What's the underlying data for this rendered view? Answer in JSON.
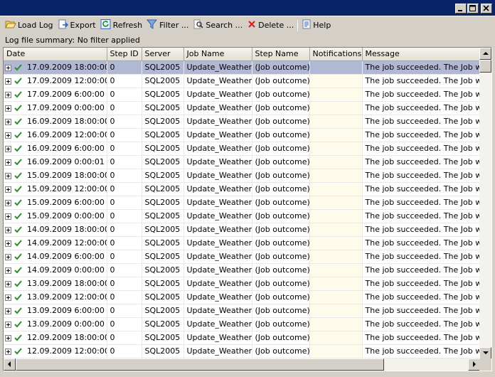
{
  "window": {
    "buttons": [
      "minimize-icon",
      "maximize-icon",
      "close-icon"
    ]
  },
  "toolbar": {
    "items": [
      {
        "label": "Load Log",
        "icon": "folder-open-icon"
      },
      {
        "label": "Export",
        "icon": "export-icon"
      },
      {
        "label": "Refresh",
        "icon": "refresh-icon"
      },
      {
        "label": "Filter ...",
        "icon": "filter-icon"
      },
      {
        "label": "Search ...",
        "icon": "search-icon"
      },
      {
        "label": "Delete ...",
        "icon": "delete-icon"
      },
      {
        "label": "Help",
        "icon": "help-icon"
      }
    ]
  },
  "summary": "Log file summary: No filter applied",
  "table": {
    "columns": [
      "Date",
      "Step ID",
      "Server",
      "Job Name",
      "Step Name",
      "Notifications",
      "Message"
    ],
    "rows": [
      {
        "date": "17.09.2009 18:00:00",
        "step_id": "0",
        "server": "SQL2005",
        "job": "Update_Weather",
        "step": "(Job outcome)",
        "notif": "",
        "message": "The job succeeded.  The Job was",
        "selected": true
      },
      {
        "date": "17.09.2009 12:00:00",
        "step_id": "0",
        "server": "SQL2005",
        "job": "Update_Weather",
        "step": "(Job outcome)",
        "notif": "",
        "message": "The job succeeded.  The Job was"
      },
      {
        "date": "17.09.2009 6:00:00",
        "step_id": "0",
        "server": "SQL2005",
        "job": "Update_Weather",
        "step": "(Job outcome)",
        "notif": "",
        "message": "The job succeeded.  The Job was"
      },
      {
        "date": "17.09.2009 0:00:00",
        "step_id": "0",
        "server": "SQL2005",
        "job": "Update_Weather",
        "step": "(Job outcome)",
        "notif": "",
        "message": "The job succeeded.  The Job was"
      },
      {
        "date": "16.09.2009 18:00:00",
        "step_id": "0",
        "server": "SQL2005",
        "job": "Update_Weather",
        "step": "(Job outcome)",
        "notif": "",
        "message": "The job succeeded.  The Job was"
      },
      {
        "date": "16.09.2009 12:00:00",
        "step_id": "0",
        "server": "SQL2005",
        "job": "Update_Weather",
        "step": "(Job outcome)",
        "notif": "",
        "message": "The job succeeded.  The Job was"
      },
      {
        "date": "16.09.2009 6:00:00",
        "step_id": "0",
        "server": "SQL2005",
        "job": "Update_Weather",
        "step": "(Job outcome)",
        "notif": "",
        "message": "The job succeeded.  The Job was"
      },
      {
        "date": "16.09.2009 0:00:01",
        "step_id": "0",
        "server": "SQL2005",
        "job": "Update_Weather",
        "step": "(Job outcome)",
        "notif": "",
        "message": "The job succeeded.  The Job was"
      },
      {
        "date": "15.09.2009 18:00:00",
        "step_id": "0",
        "server": "SQL2005",
        "job": "Update_Weather",
        "step": "(Job outcome)",
        "notif": "",
        "message": "The job succeeded.  The Job was"
      },
      {
        "date": "15.09.2009 12:00:00",
        "step_id": "0",
        "server": "SQL2005",
        "job": "Update_Weather",
        "step": "(Job outcome)",
        "notif": "",
        "message": "The job succeeded.  The Job was"
      },
      {
        "date": "15.09.2009 6:00:00",
        "step_id": "0",
        "server": "SQL2005",
        "job": "Update_Weather",
        "step": "(Job outcome)",
        "notif": "",
        "message": "The job succeeded.  The Job was"
      },
      {
        "date": "15.09.2009 0:00:00",
        "step_id": "0",
        "server": "SQL2005",
        "job": "Update_Weather",
        "step": "(Job outcome)",
        "notif": "",
        "message": "The job succeeded.  The Job was"
      },
      {
        "date": "14.09.2009 18:00:00",
        "step_id": "0",
        "server": "SQL2005",
        "job": "Update_Weather",
        "step": "(Job outcome)",
        "notif": "",
        "message": "The job succeeded.  The Job was"
      },
      {
        "date": "14.09.2009 12:00:00",
        "step_id": "0",
        "server": "SQL2005",
        "job": "Update_Weather",
        "step": "(Job outcome)",
        "notif": "",
        "message": "The job succeeded.  The Job was"
      },
      {
        "date": "14.09.2009 6:00:00",
        "step_id": "0",
        "server": "SQL2005",
        "job": "Update_Weather",
        "step": "(Job outcome)",
        "notif": "",
        "message": "The job succeeded.  The Job was"
      },
      {
        "date": "14.09.2009 0:00:00",
        "step_id": "0",
        "server": "SQL2005",
        "job": "Update_Weather",
        "step": "(Job outcome)",
        "notif": "",
        "message": "The job succeeded.  The Job was"
      },
      {
        "date": "13.09.2009 18:00:00",
        "step_id": "0",
        "server": "SQL2005",
        "job": "Update_Weather",
        "step": "(Job outcome)",
        "notif": "",
        "message": "The job succeeded.  The Job was"
      },
      {
        "date": "13.09.2009 12:00:00",
        "step_id": "0",
        "server": "SQL2005",
        "job": "Update_Weather",
        "step": "(Job outcome)",
        "notif": "",
        "message": "The job succeeded.  The Job was"
      },
      {
        "date": "13.09.2009 6:00:00",
        "step_id": "0",
        "server": "SQL2005",
        "job": "Update_Weather",
        "step": "(Job outcome)",
        "notif": "",
        "message": "The job succeeded.  The Job was"
      },
      {
        "date": "13.09.2009 0:00:00",
        "step_id": "0",
        "server": "SQL2005",
        "job": "Update_Weather",
        "step": "(Job outcome)",
        "notif": "",
        "message": "The job succeeded.  The Job was"
      },
      {
        "date": "12.09.2009 18:00:00",
        "step_id": "0",
        "server": "SQL2005",
        "job": "Update_Weather",
        "step": "(Job outcome)",
        "notif": "",
        "message": "The job succeeded.  The Job was"
      },
      {
        "date": "12.09.2009 12:00:00",
        "step_id": "0",
        "server": "SQL2005",
        "job": "Update_Weather",
        "step": "(Job outcome)",
        "notif": "",
        "message": "The job succeeded.  The Job was"
      }
    ]
  },
  "colors": {
    "titlebar": "#0a246a",
    "selected_row": "#b1b8d4",
    "notifications_column": "#fffbea",
    "check": "#2e8b2e"
  }
}
